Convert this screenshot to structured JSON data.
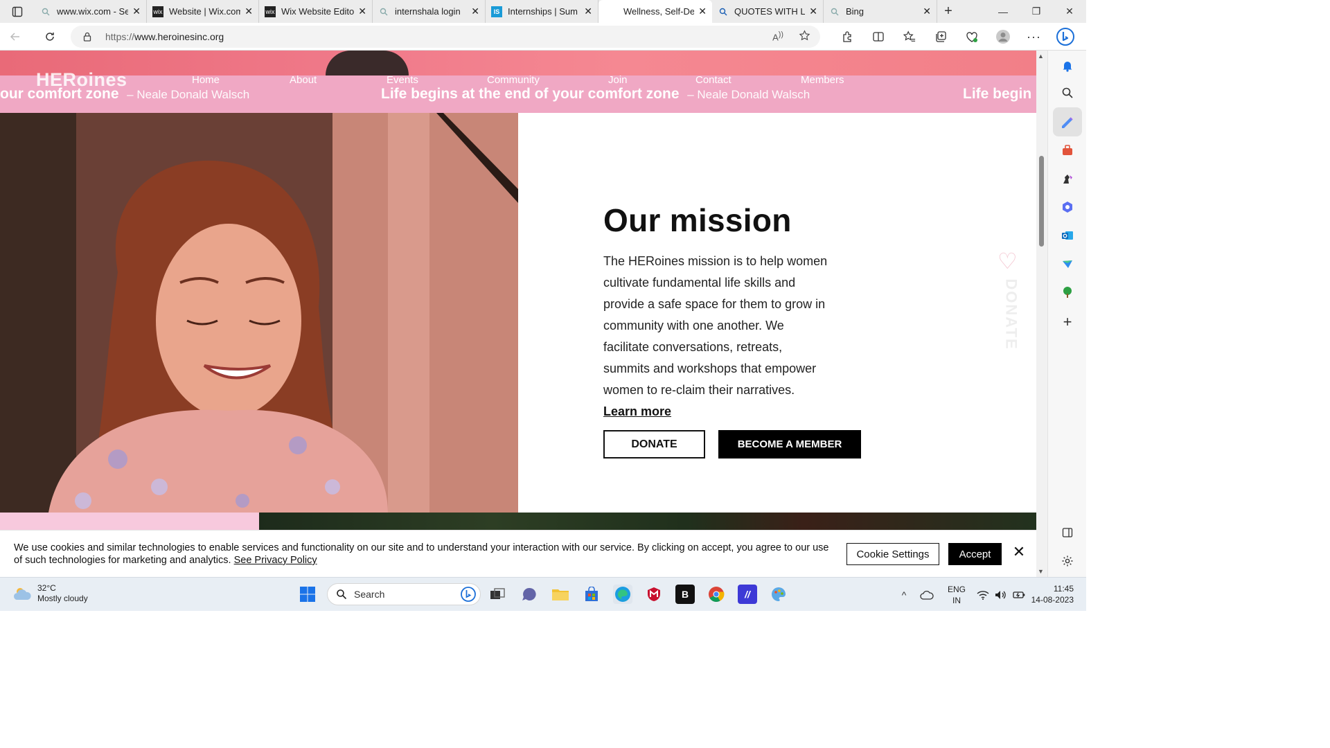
{
  "browser": {
    "tabs": [
      {
        "title": "www.wix.com - Se",
        "favicon": "search-icon"
      },
      {
        "title": "Website | Wix.com",
        "favicon": "wix-icon"
      },
      {
        "title": "Wix Website Edito",
        "favicon": "wix-icon"
      },
      {
        "title": "internshala login",
        "favicon": "search-icon"
      },
      {
        "title": "Internships | Sum",
        "favicon": "internshala-icon"
      },
      {
        "title": "Wellness, Self-De",
        "favicon": "none",
        "active": true
      },
      {
        "title": "QUOTES WITH LE",
        "favicon": "search-icon"
      },
      {
        "title": "Bing",
        "favicon": "search-icon"
      }
    ],
    "url_protocol": "https://",
    "url_host": "www.heroinesinc.org"
  },
  "site": {
    "logo": "HERoines",
    "nav": [
      "Home",
      "About",
      "Events",
      "Community",
      "Join",
      "Contact",
      "Members"
    ],
    "marquee": {
      "quote_tail": "our comfort zone",
      "quote": "Life begins at the end of your comfort zone",
      "author": "– Neale Donald Walsch",
      "quote_head": "Life begin"
    },
    "mission": {
      "title": "Our mission",
      "body": "The HERoines mission is to help women cultivate fundamental life skills and provide a safe space for them to grow in community with one another. We facilitate conversations, retreats, summits and workshops that empower women to re-claim their narratives.",
      "learn_more": "Learn more"
    },
    "buttons": {
      "donate": "DONATE",
      "member": "BECOME A MEMBER"
    },
    "side_donate": "DONATE"
  },
  "cookie": {
    "text": "We use cookies and similar technologies to enable services and functionality on our site and to understand your interaction with our service. By clicking on accept, you agree to our use of such technologies for marketing and analytics.",
    "privacy_link": "See Privacy Policy",
    "settings": "Cookie Settings",
    "accept": "Accept"
  },
  "taskbar": {
    "weather_temp": "32°C",
    "weather_desc": "Mostly cloudy",
    "search": "Search",
    "lang_top": "ENG",
    "lang_bottom": "IN",
    "time": "11:45",
    "date": "14-08-2023"
  },
  "colors": {
    "pink_bar": "#f0a8c4",
    "accent_black": "#000000"
  }
}
